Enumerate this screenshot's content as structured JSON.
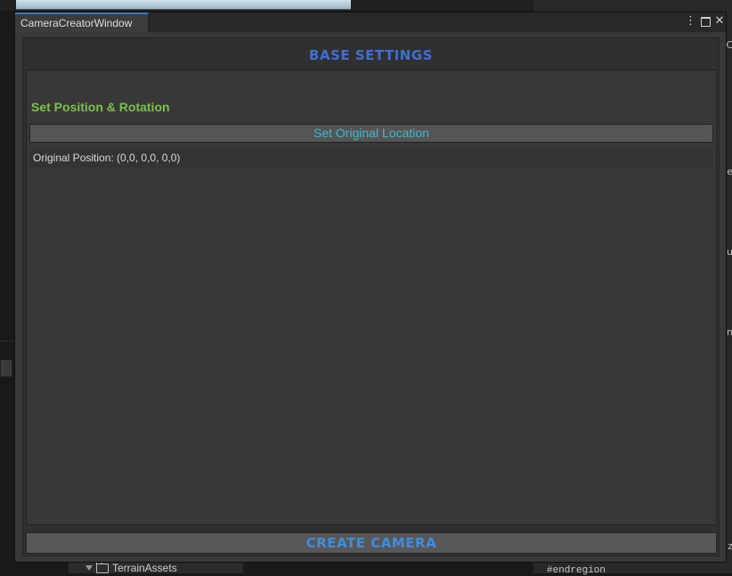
{
  "window": {
    "tab_title": "CameraCreatorWindow",
    "kebab_glyph": "⋮",
    "close_glyph": "✕"
  },
  "base_settings": {
    "title": "BASE SETTINGS",
    "subheading": "Set Position & Rotation",
    "set_location_button": "Set Original Location",
    "original_position_label": "Original Position: (0,0, 0,0, 0,0)"
  },
  "create_button": "CREATE CAMERA",
  "background": {
    "right_panel_letters": [
      "C",
      "e",
      "u",
      "n",
      "z"
    ],
    "project_folder": "TerrainAssets",
    "code_text": "#endregion"
  },
  "colors": {
    "section_title": "#3f6fd6",
    "subheading": "#7cc04a",
    "set_button_text": "#41b6c9",
    "create_button_text": "#3f8cde",
    "tab_accent": "#3a79bb"
  }
}
